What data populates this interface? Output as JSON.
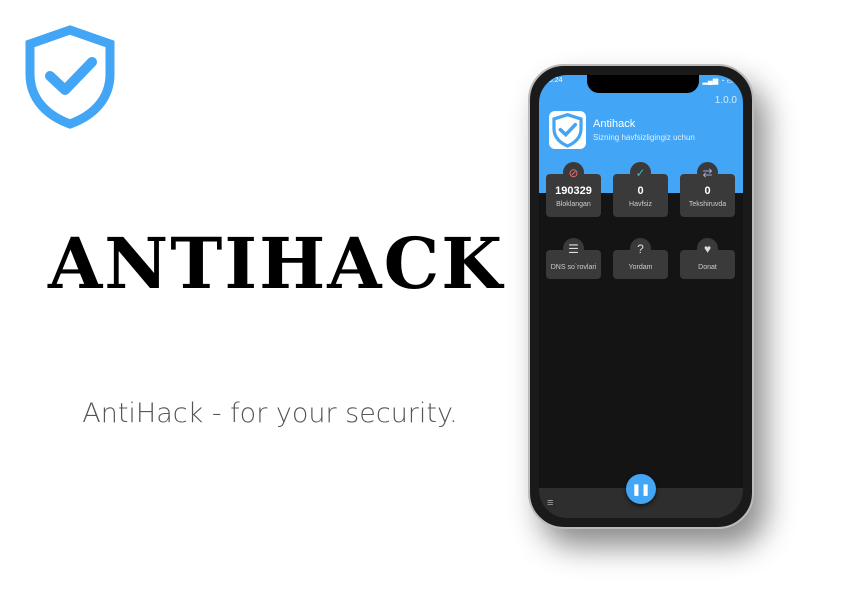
{
  "headline": "ANTIHACK",
  "tagline": "AntiHack - for your security.",
  "phone": {
    "status_time": "18:24",
    "version": "1.0.0",
    "app_name": "Antihack",
    "app_subtitle": "Sizning havfsizligingiz uchun",
    "stats": [
      {
        "icon": "block-icon",
        "value": "190329",
        "label": "Bloklangan",
        "color": "#e57373"
      },
      {
        "icon": "check-icon",
        "value": "0",
        "label": "Havfsiz",
        "color": "#4db6ac"
      },
      {
        "icon": "swap-icon",
        "value": "0",
        "label": "Tekshiruvda",
        "color": "#9fa8da"
      }
    ],
    "actions": [
      {
        "icon": "dns-list-icon",
        "label": "DNS so`rovlari"
      },
      {
        "icon": "help-icon",
        "label": "Yordam"
      },
      {
        "icon": "heart-icon",
        "label": "Donat"
      }
    ],
    "accent": "#42a5f5"
  }
}
